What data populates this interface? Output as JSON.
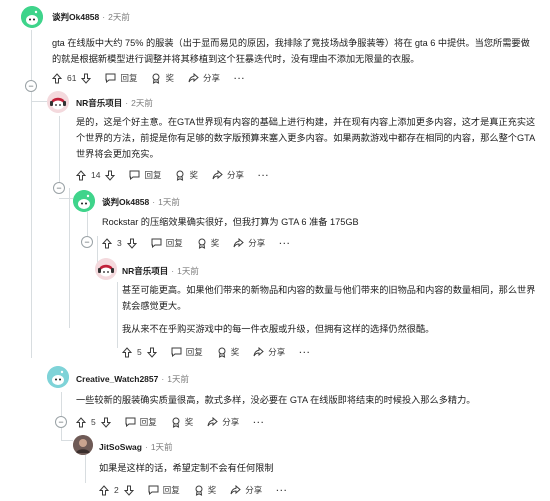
{
  "comments": [
    {
      "author": "谈判Ok4858",
      "time": "2天前",
      "text": "gta 在线版中大约 75% 的服装（出于显而易见的原因，我排除了竞技场战争服装等）将在 gta 6 中提供。当您所需要做的就是根据新模型进行调整并将其移植到这个狂暴迭代时，没有理由不添加无限量的衣服。",
      "votes": "61",
      "reply_label": "回复",
      "award_label": "奖",
      "share_label": "分享",
      "more": "···"
    },
    {
      "author": "NR音乐项目",
      "time": "2天前",
      "text": "是的，这是个好主意。在GTA世界现有内容的基础上进行构建，并在现有内容上添加更多内容，这才是真正充实这个世界的方法，前提是你有足够的数字版预算来塞入更多内容。如果两款游戏中都存在相同的内容，那么整个GTA世界将会更加充实。",
      "votes": "14",
      "reply_label": "回复",
      "award_label": "奖",
      "share_label": "分享",
      "more": "···"
    },
    {
      "author": "谈判Ok4858",
      "time": "1天前",
      "text": "Rockstar 的压缩效果确实很好，但我打算为 GTA 6 准备 175GB",
      "votes": "3",
      "reply_label": "回复",
      "award_label": "奖",
      "share_label": "分享",
      "more": "···"
    },
    {
      "author": "NR音乐项目",
      "time": "1天前",
      "text": "甚至可能更高。如果他们带来的新物品和内容的数量与他们带来的旧物品和内容的数量相同，那么世界就会感觉更大。",
      "text2": "我从来不在乎购买游戏中的每一件衣服或升级，但拥有这样的选择仍然很酷。",
      "votes": "5",
      "reply_label": "回复",
      "award_label": "奖",
      "share_label": "分享",
      "more": "···"
    },
    {
      "author": "Creative_Watch2857",
      "time": "1天前",
      "text": "一些较新的服装确实质量很高，款式多样，没必要在 GTA 在线版即将结束的时候投入那么多精力。",
      "votes": "5",
      "reply_label": "回复",
      "award_label": "奖",
      "share_label": "分享",
      "more": "···"
    },
    {
      "author": "JitSoSwag",
      "time": "1天前",
      "text": "如果是这样的话，希望定制不会有任何限制",
      "votes": "2",
      "reply_label": "回复",
      "award_label": "奖",
      "share_label": "分享",
      "more": "···"
    }
  ],
  "separator": "·",
  "colors": {
    "meta_gray": "#7c7c7c",
    "thread_line": "#d8dde0",
    "snoo_green": "#3fd48b"
  }
}
